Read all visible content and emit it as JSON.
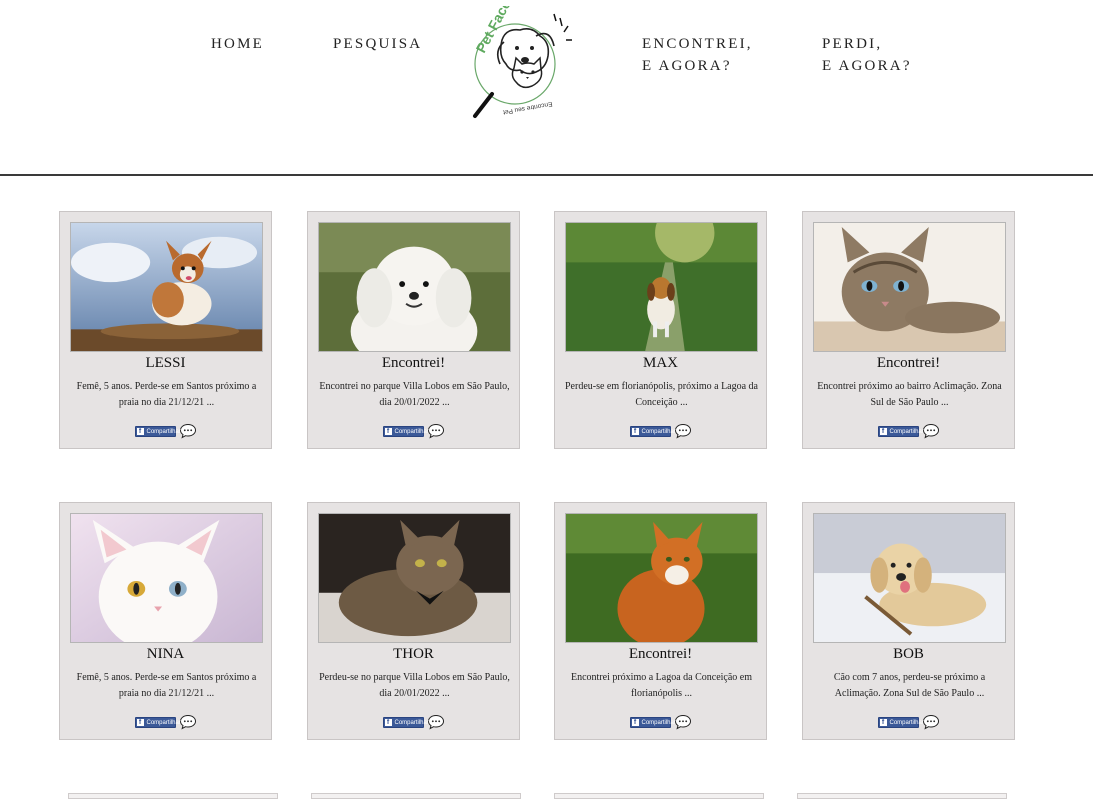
{
  "nav": {
    "home": "HOME",
    "search": "PESQUISA",
    "found_line1": "ENCONTREI,",
    "found_line2": "E AGORA?",
    "lost_line1": "PERDI,",
    "lost_line2": "E AGORA?"
  },
  "logo": {
    "name": "Pet Face",
    "tagline": "Encontre seu Pet"
  },
  "cards": [
    {
      "title": "LESSI",
      "desc": "Femê, 5 anos. Perde-se em Santos próximo a praia no dia 21/12/21 ...",
      "photo": "chihuahua-dog",
      "share_label": "Compartilhar"
    },
    {
      "title": "Encontrei!",
      "desc": "Encontrei no parque Villa Lobos em São Paulo, dia 20/01/2022 ...",
      "photo": "white-poodle",
      "share_label": "Compartilhar"
    },
    {
      "title": "MAX",
      "desc": "Perdeu-se em florianópolis, próximo a Lagoa da Conceição ...",
      "photo": "beagle-on-path",
      "share_label": "Compartilhar"
    },
    {
      "title": "Encontrei!",
      "desc": "Encontrei próximo ao bairro Aclimação. Zona Sul de São Paulo ...",
      "photo": "tabby-cat",
      "share_label": "Compartilhar"
    },
    {
      "title": "NINA",
      "desc": "Femê, 5 anos. Perde-se em Santos próximo a praia no dia 21/12/21 ...",
      "photo": "white-cat",
      "share_label": "Compartilhar"
    },
    {
      "title": "THOR",
      "desc": "Perdeu-se no parque Villa Lobos em São Paulo, dia 20/01/2022 ...",
      "photo": "maine-coon-cat",
      "share_label": "Compartilhar"
    },
    {
      "title": "Encontrei!",
      "desc": "Encontrei próximo a Lagoa da Conceição em florianópolis ...",
      "photo": "orange-cat",
      "share_label": "Compartilhar"
    },
    {
      "title": "BOB",
      "desc": "Cão com 7 anos, perdeu-se próximo a Aclimação. Zona Sul de São Paulo ...",
      "photo": "golden-retriever",
      "share_label": "Compartilhar"
    }
  ]
}
